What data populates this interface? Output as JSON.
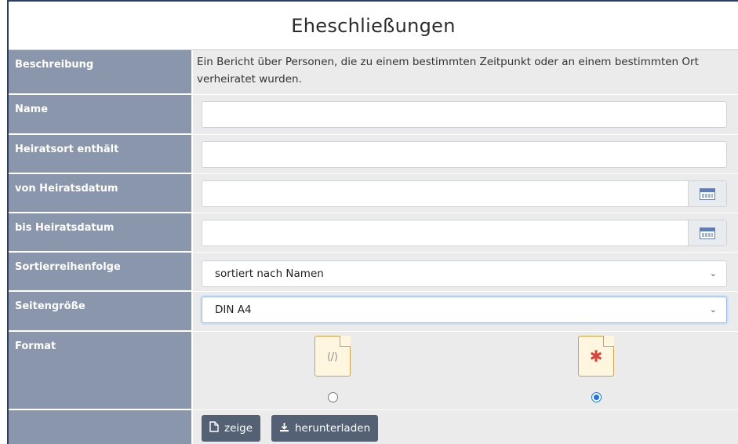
{
  "title": "Eheschließungen",
  "description": {
    "label": "Beschreibung",
    "text": "Ein Bericht über Personen, die zu einem bestimmten Zeitpunkt oder an einem bestimmten Ort verheiratet wurden."
  },
  "name": {
    "label": "Name",
    "value": ""
  },
  "place": {
    "label": "Heiratsort enthält",
    "value": ""
  },
  "date_from": {
    "label": "von Heiratsdatum",
    "value": "",
    "icon": "calendar-icon"
  },
  "date_to": {
    "label": "bis Heiratsdatum",
    "value": "",
    "icon": "calendar-icon"
  },
  "sort": {
    "label": "Sortierreihenfolge",
    "selected": "sortiert nach Namen"
  },
  "page_size": {
    "label": "Seitengröße",
    "selected": "DIN A4"
  },
  "format": {
    "label": "Format",
    "options": [
      {
        "icon": "html-file-icon",
        "selected": false
      },
      {
        "icon": "pdf-file-icon",
        "selected": true
      }
    ]
  },
  "actions": {
    "show_label": "zeige",
    "show_icon": "file-icon",
    "download_label": "herunterladen",
    "download_icon": "download-icon"
  },
  "colors": {
    "label_bg": "#8a96ac",
    "field_bg": "#ebebeb",
    "button_bg": "#546074",
    "frame_border": "#2a3d6b",
    "radio_accent": "#1a73e8"
  }
}
